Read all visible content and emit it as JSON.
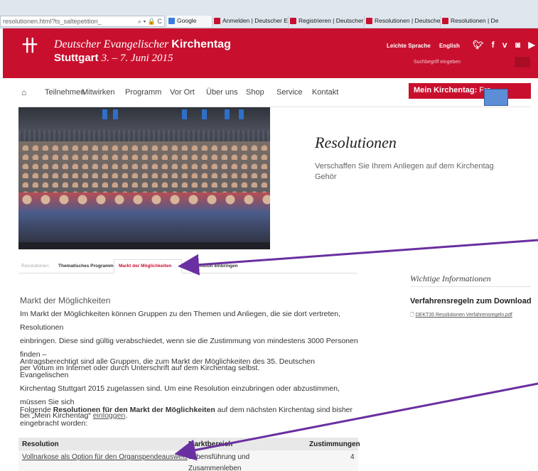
{
  "browser": {
    "url": "resolutionen.html?ts_saltepetition_",
    "url_controls": "⌕ ▾ 🔒 C",
    "tabs": [
      {
        "label": "Google",
        "favicon": "google-icon"
      },
      {
        "label": "Anmelden | Deutscher Evangel...",
        "favicon": "kirchentag-icon"
      },
      {
        "label": "Registrieren | Deutscher Evang...",
        "favicon": "kirchentag-icon"
      },
      {
        "label": "Resolutionen | Deutscher Evan...",
        "favicon": "kirchentag-icon"
      },
      {
        "label": "Resolutionen | De",
        "favicon": "kirchentag-icon"
      }
    ]
  },
  "header": {
    "brand_italic": "Deutscher Evangelischer",
    "brand_bold": "Kirchentag",
    "city": "Stuttgart",
    "dates": "3. – 7. Juni 2015",
    "leichte_sprache": "Leichte Sprache",
    "english": "English",
    "social_icons": [
      "twitter-icon",
      "facebook-icon",
      "vimeo-icon",
      "instagram-icon",
      "youtube-icon"
    ],
    "search_placeholder": "Suchbegriff eingeben",
    "accent_color": "#c8102e"
  },
  "nav": {
    "items": [
      "Teilnehmen",
      "Mitwirken",
      "Programm",
      "Vor Ort",
      "Über uns",
      "Shop",
      "Service",
      "Kontakt"
    ],
    "mein_label": "Mein Kirchentag:",
    "mein_user": "Fra"
  },
  "hero": {
    "title": "Resolutionen",
    "subtitle": "Verschaffen Sie Ihrem Anliegen auf dem Kirchentag Gehör"
  },
  "subnav": {
    "prefix": "Resolutionen:",
    "items": [
      "Thematisches Programm",
      "Markt der Möglichkeiten",
      "Resolution einbringen"
    ],
    "active_index": 1
  },
  "content": {
    "section_title": "Markt der Möglichkeiten",
    "p1_lines": [
      "Im Markt der Möglichkeiten können Gruppen zu den Themen und Anliegen, die sie dort vertreten, Resolutionen",
      "einbringen. Diese sind gültig verabschiedet, wenn sie die Zustimmung von mindestens 3000 Personen finden –",
      "per Votum im Internet oder durch Unterschrift auf dem Kirchentag selbst."
    ],
    "p2_lines": [
      "Antragsberechtigt sind alle Gruppen, die zum Markt der Möglichkeiten des 35. Deutschen Evangelischen",
      "Kirchentag Stuttgart 2015 zugelassen sind. Um eine Resolution einzubringen oder abzustimmen, müssen Sie sich"
    ],
    "p2_last_prefix": "bei „Mein Kirchentag“ ",
    "p2_last_link": "einloggen",
    "p2_last_suffix": ".",
    "p3_prefix": "Folgende ",
    "p3_bold": "Resolutionen für den Markt der Möglichkeiten",
    "p3_suffix": " auf dem nächsten Kirchentag sind bisher",
    "p3_line2": "eingebracht worden:"
  },
  "table": {
    "headers": [
      "Resolution",
      "Marktbereich",
      "Zustimmungen"
    ],
    "rows": [
      {
        "resolution": "Vollnarkose als Option für den Organspendeausweis",
        "bereich_line1": "Lebensführung und",
        "bereich_line2": "Zusammenleben",
        "zustimmungen": "4"
      }
    ]
  },
  "sidebar": {
    "title": "Wichtige Informationen",
    "heading": "Verfahrensregeln zum Download",
    "download": "DEKT35 Resolutionen Verfahrensregeln.pdf"
  },
  "annotation_color": "#6a2fa0"
}
